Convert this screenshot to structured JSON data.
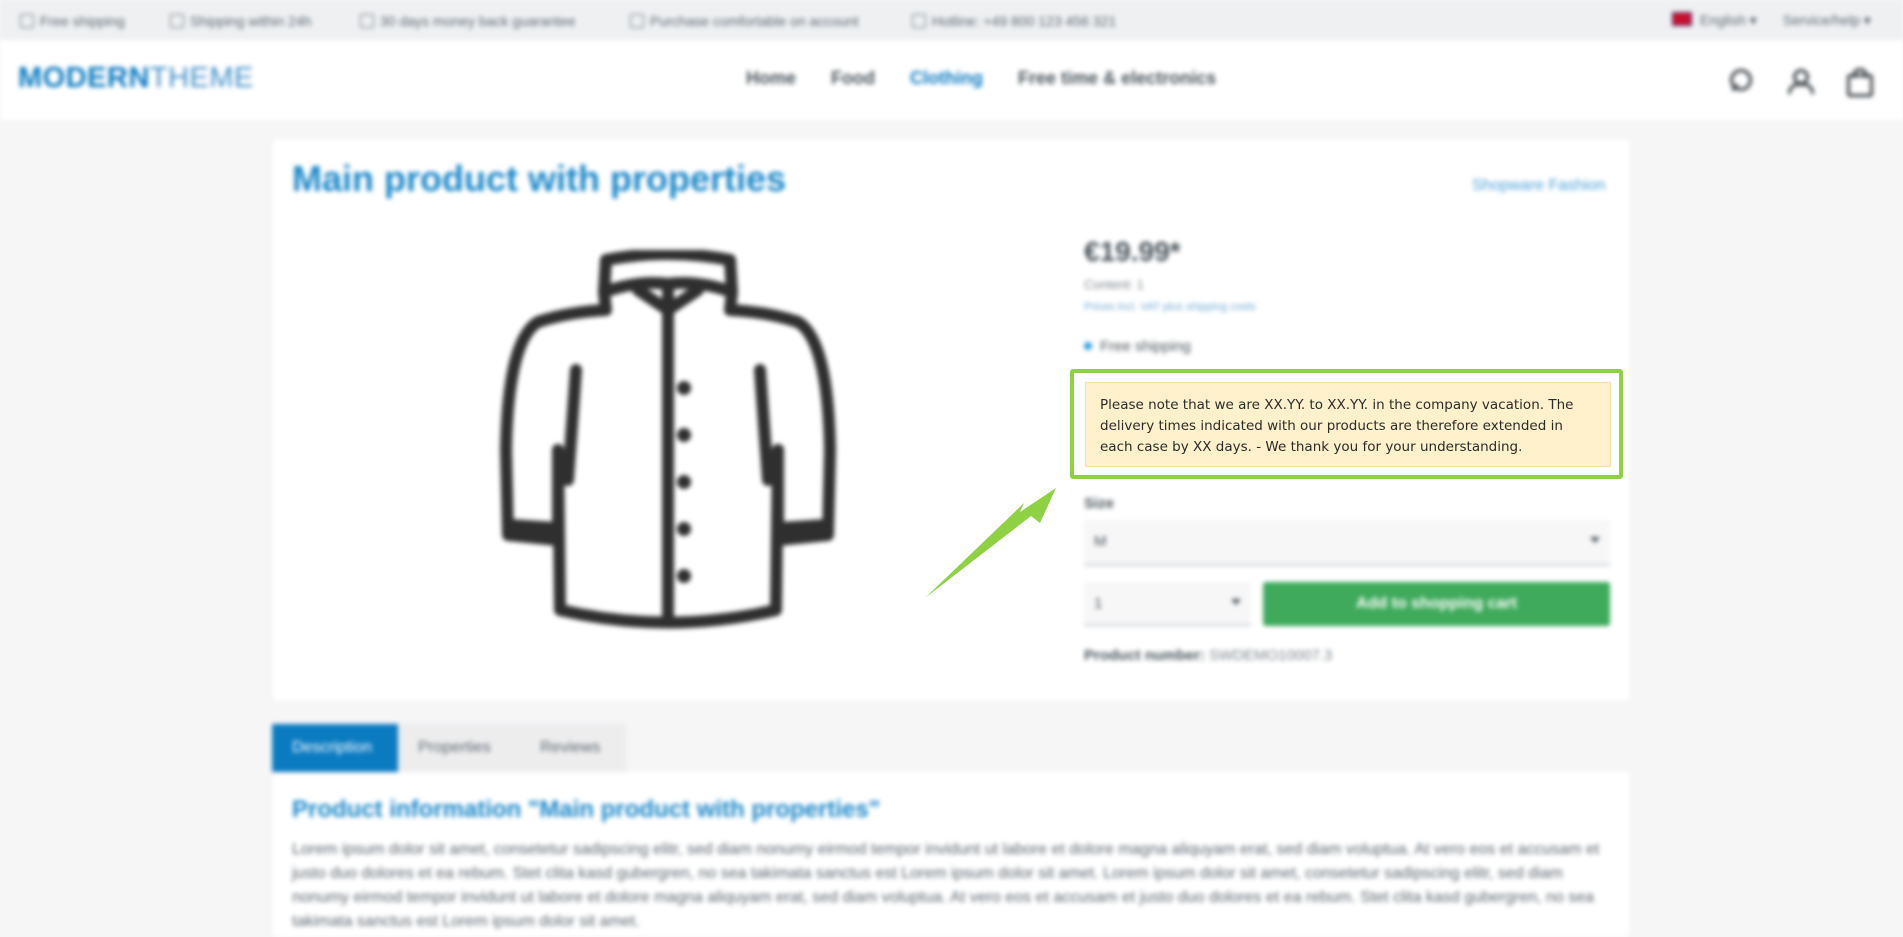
{
  "topbar": {
    "usps": [
      {
        "label": "Free shipping",
        "icon": "truck-icon"
      },
      {
        "label": "Shipping within 24h",
        "icon": "clock-icon"
      },
      {
        "label": "30 days money back guarantee",
        "icon": "money-icon"
      },
      {
        "label": "Purchase comfortable on account",
        "icon": "invoice-icon"
      },
      {
        "label": "Hotline: +49 800 123 456 321",
        "icon": "headset-icon"
      }
    ],
    "language": "English",
    "service": "Service/help"
  },
  "header": {
    "logo_bold": "MODERN",
    "logo_thin": "THEME",
    "nav": [
      "Home",
      "Food",
      "Clothing",
      "Free time & electronics"
    ],
    "active_nav": "Clothing",
    "icons": [
      "search-icon",
      "account-icon",
      "cart-icon"
    ]
  },
  "product": {
    "title": "Main product with properties",
    "manufacturer": "Shopware Fashion",
    "price": "€19.99*",
    "content": "Content: 1",
    "tax_note": "Prices incl. VAT plus shipping costs",
    "shipping": "Free shipping",
    "notice": "Please note that we are XX.YY. to XX.YY. in the company vacation. The delivery times indicated with our products are therefore extended in each case by XX days. - We thank you for your understanding.",
    "size_label": "Size",
    "size_value": "M",
    "quantity": "1",
    "add_to_cart": "Add to shopping cart",
    "number_label": "Product number:",
    "number_value": "SWDEMO10007.3",
    "image_icon": "jacket-icon"
  },
  "tabs": [
    "Description",
    "Properties",
    "Reviews"
  ],
  "description": {
    "title": "Product information \"Main product with properties\"",
    "text": "Lorem ipsum dolor sit amet, consetetur sadipscing elitr, sed diam nonumy eirmod tempor invidunt ut labore et dolore magna aliquyam erat, sed diam voluptua. At vero eos et accusam et justo duo dolores et ea rebum. Stet clita kasd gubergren, no sea takimata sanctus est Lorem ipsum dolor sit amet. Lorem ipsum dolor sit amet, consetetur sadipscing elitr, sed diam nonumy eirmod tempor invidunt ut labore et dolore magna aliquyam erat, sed diam voluptua. At vero eos et accusam et justo duo dolores et ea rebum. Stet clita kasd gubergren, no sea takimata sanctus est Lorem ipsum dolor sit amet."
  },
  "colors": {
    "highlight": "#8ed143",
    "brand": "#0b7bc1",
    "cart_button": "#3faa5c",
    "notice_bg": "#fff1cc"
  }
}
